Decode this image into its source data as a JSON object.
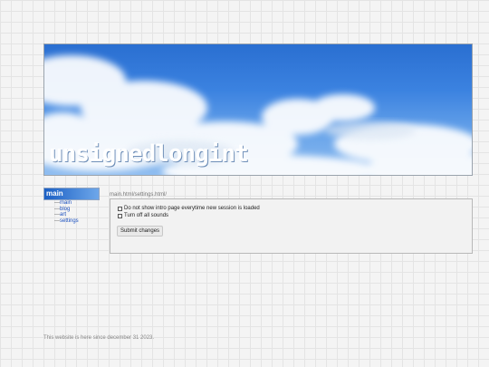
{
  "site": {
    "title": "unsignedlongint"
  },
  "sidebar": {
    "heading": "main",
    "items": [
      {
        "label": "main"
      },
      {
        "label": "blog"
      },
      {
        "label": "art"
      },
      {
        "label": "settings"
      }
    ]
  },
  "main": {
    "path": "main.html/settings.html/",
    "options": [
      {
        "label": "Do not show intro page everytime new session is loaded",
        "checked": false
      },
      {
        "label": "Turn off all sounds",
        "checked": false
      }
    ],
    "submit_label": "Submit changes"
  },
  "footer": {
    "text": "This website is here since december 31 2023."
  },
  "colors": {
    "accent": "#1a5fc4",
    "sky": "#2a6fd1"
  }
}
